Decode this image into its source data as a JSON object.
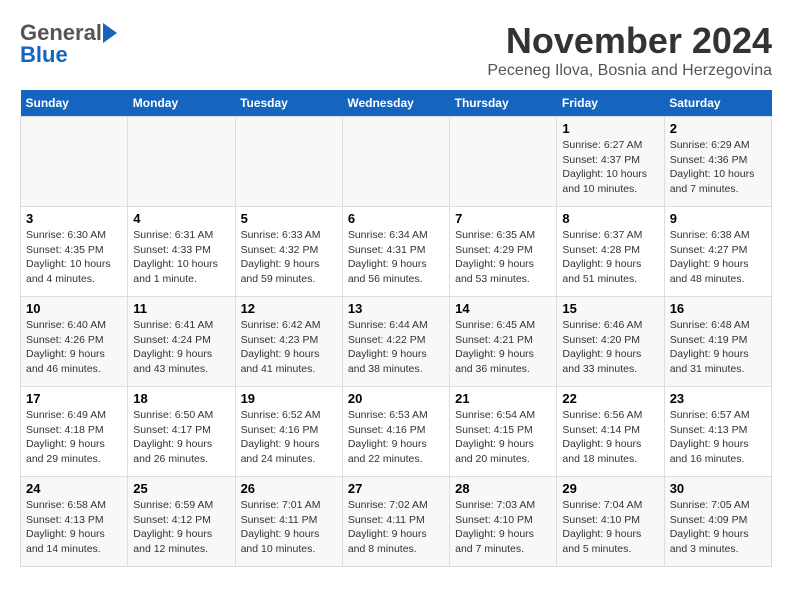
{
  "logo": {
    "general": "General",
    "blue": "Blue"
  },
  "header": {
    "month_year": "November 2024",
    "location": "Peceneg Ilova, Bosnia and Herzegovina"
  },
  "days_of_week": [
    "Sunday",
    "Monday",
    "Tuesday",
    "Wednesday",
    "Thursday",
    "Friday",
    "Saturday"
  ],
  "weeks": [
    {
      "days": [
        {
          "num": "",
          "info": ""
        },
        {
          "num": "",
          "info": ""
        },
        {
          "num": "",
          "info": ""
        },
        {
          "num": "",
          "info": ""
        },
        {
          "num": "",
          "info": ""
        },
        {
          "num": "1",
          "info": "Sunrise: 6:27 AM\nSunset: 4:37 PM\nDaylight: 10 hours and 10 minutes."
        },
        {
          "num": "2",
          "info": "Sunrise: 6:29 AM\nSunset: 4:36 PM\nDaylight: 10 hours and 7 minutes."
        }
      ]
    },
    {
      "days": [
        {
          "num": "3",
          "info": "Sunrise: 6:30 AM\nSunset: 4:35 PM\nDaylight: 10 hours and 4 minutes."
        },
        {
          "num": "4",
          "info": "Sunrise: 6:31 AM\nSunset: 4:33 PM\nDaylight: 10 hours and 1 minute."
        },
        {
          "num": "5",
          "info": "Sunrise: 6:33 AM\nSunset: 4:32 PM\nDaylight: 9 hours and 59 minutes."
        },
        {
          "num": "6",
          "info": "Sunrise: 6:34 AM\nSunset: 4:31 PM\nDaylight: 9 hours and 56 minutes."
        },
        {
          "num": "7",
          "info": "Sunrise: 6:35 AM\nSunset: 4:29 PM\nDaylight: 9 hours and 53 minutes."
        },
        {
          "num": "8",
          "info": "Sunrise: 6:37 AM\nSunset: 4:28 PM\nDaylight: 9 hours and 51 minutes."
        },
        {
          "num": "9",
          "info": "Sunrise: 6:38 AM\nSunset: 4:27 PM\nDaylight: 9 hours and 48 minutes."
        }
      ]
    },
    {
      "days": [
        {
          "num": "10",
          "info": "Sunrise: 6:40 AM\nSunset: 4:26 PM\nDaylight: 9 hours and 46 minutes."
        },
        {
          "num": "11",
          "info": "Sunrise: 6:41 AM\nSunset: 4:24 PM\nDaylight: 9 hours and 43 minutes."
        },
        {
          "num": "12",
          "info": "Sunrise: 6:42 AM\nSunset: 4:23 PM\nDaylight: 9 hours and 41 minutes."
        },
        {
          "num": "13",
          "info": "Sunrise: 6:44 AM\nSunset: 4:22 PM\nDaylight: 9 hours and 38 minutes."
        },
        {
          "num": "14",
          "info": "Sunrise: 6:45 AM\nSunset: 4:21 PM\nDaylight: 9 hours and 36 minutes."
        },
        {
          "num": "15",
          "info": "Sunrise: 6:46 AM\nSunset: 4:20 PM\nDaylight: 9 hours and 33 minutes."
        },
        {
          "num": "16",
          "info": "Sunrise: 6:48 AM\nSunset: 4:19 PM\nDaylight: 9 hours and 31 minutes."
        }
      ]
    },
    {
      "days": [
        {
          "num": "17",
          "info": "Sunrise: 6:49 AM\nSunset: 4:18 PM\nDaylight: 9 hours and 29 minutes."
        },
        {
          "num": "18",
          "info": "Sunrise: 6:50 AM\nSunset: 4:17 PM\nDaylight: 9 hours and 26 minutes."
        },
        {
          "num": "19",
          "info": "Sunrise: 6:52 AM\nSunset: 4:16 PM\nDaylight: 9 hours and 24 minutes."
        },
        {
          "num": "20",
          "info": "Sunrise: 6:53 AM\nSunset: 4:16 PM\nDaylight: 9 hours and 22 minutes."
        },
        {
          "num": "21",
          "info": "Sunrise: 6:54 AM\nSunset: 4:15 PM\nDaylight: 9 hours and 20 minutes."
        },
        {
          "num": "22",
          "info": "Sunrise: 6:56 AM\nSunset: 4:14 PM\nDaylight: 9 hours and 18 minutes."
        },
        {
          "num": "23",
          "info": "Sunrise: 6:57 AM\nSunset: 4:13 PM\nDaylight: 9 hours and 16 minutes."
        }
      ]
    },
    {
      "days": [
        {
          "num": "24",
          "info": "Sunrise: 6:58 AM\nSunset: 4:13 PM\nDaylight: 9 hours and 14 minutes."
        },
        {
          "num": "25",
          "info": "Sunrise: 6:59 AM\nSunset: 4:12 PM\nDaylight: 9 hours and 12 minutes."
        },
        {
          "num": "26",
          "info": "Sunrise: 7:01 AM\nSunset: 4:11 PM\nDaylight: 9 hours and 10 minutes."
        },
        {
          "num": "27",
          "info": "Sunrise: 7:02 AM\nSunset: 4:11 PM\nDaylight: 9 hours and 8 minutes."
        },
        {
          "num": "28",
          "info": "Sunrise: 7:03 AM\nSunset: 4:10 PM\nDaylight: 9 hours and 7 minutes."
        },
        {
          "num": "29",
          "info": "Sunrise: 7:04 AM\nSunset: 4:10 PM\nDaylight: 9 hours and 5 minutes."
        },
        {
          "num": "30",
          "info": "Sunrise: 7:05 AM\nSunset: 4:09 PM\nDaylight: 9 hours and 3 minutes."
        }
      ]
    }
  ]
}
